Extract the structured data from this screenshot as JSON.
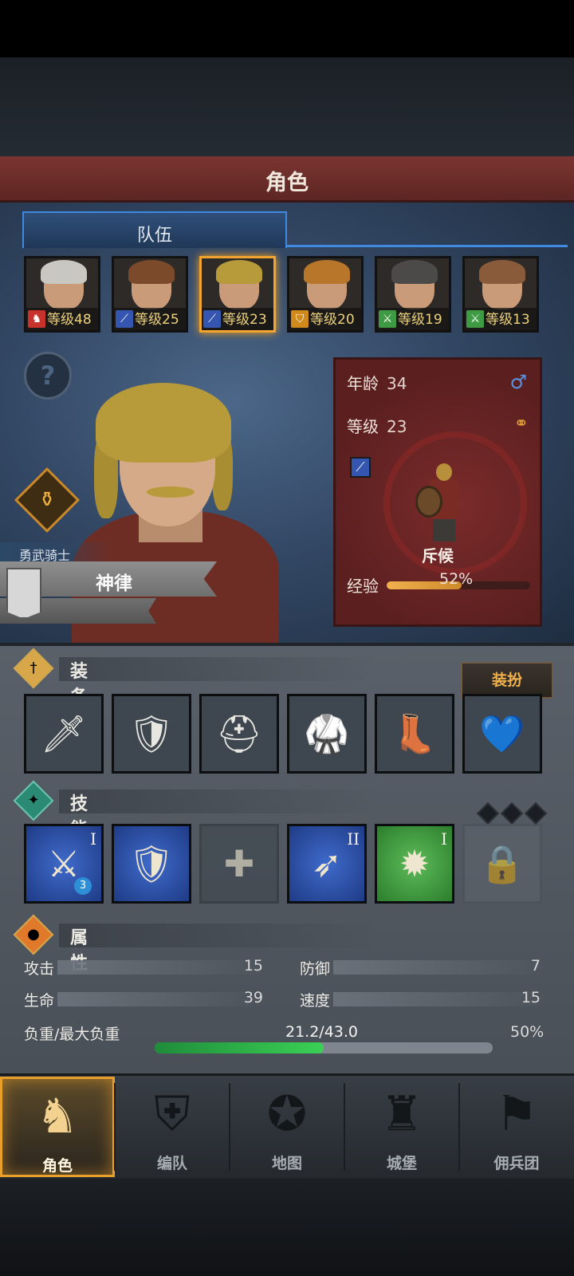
{
  "header": {
    "title": "角色"
  },
  "tabs": {
    "team_label": "队伍"
  },
  "party": [
    {
      "level_text": "等级48",
      "class_icon": "horse-icon",
      "class_color": "#c8322d",
      "hair": "#c9c7c2",
      "selected": false
    },
    {
      "level_text": "等级25",
      "class_icon": "sword-icon",
      "class_color": "#3556b0",
      "hair": "#7a4a2a",
      "selected": false
    },
    {
      "level_text": "等级23",
      "class_icon": "sword-icon",
      "class_color": "#3556b0",
      "hair": "#b79a3a",
      "selected": true
    },
    {
      "level_text": "等级20",
      "class_icon": "shield-icon",
      "class_color": "#d08a1c",
      "hair": "#b7762a",
      "selected": false
    },
    {
      "level_text": "等级19",
      "class_icon": "crossed-swords-icon",
      "class_color": "#3f9b43",
      "hair": "#4b4a48",
      "selected": false
    },
    {
      "level_text": "等级13",
      "class_icon": "crossed-swords-icon",
      "class_color": "#3f9b43",
      "hair": "#8a5b3a",
      "selected": false
    }
  ],
  "character": {
    "rank": "勇武骑士",
    "name": "神律",
    "age_label": "年龄",
    "age_value": "34",
    "level_label": "等级",
    "level_value": "23",
    "class_name": "斥候",
    "xp_label": "经验",
    "xp_value": "52%",
    "xp_fraction": 0.52
  },
  "equipment": {
    "title": "装备",
    "dress_label": "装扮",
    "slots": [
      {
        "name": "dagger",
        "icon": "🗡"
      },
      {
        "name": "round-shield",
        "icon": "🛡"
      },
      {
        "name": "leather-helmet",
        "icon": "⛑"
      },
      {
        "name": "leather-armor",
        "icon": "🥋"
      },
      {
        "name": "leather-boots",
        "icon": "👢"
      },
      {
        "name": "heart-amulet",
        "icon": "💙"
      }
    ]
  },
  "skills": {
    "title": "技能",
    "slots": [
      {
        "name": "blood-strike",
        "roman": "I",
        "badge": "3",
        "style": "blue",
        "icon": "⚔"
      },
      {
        "name": "shield-rush",
        "roman": "",
        "badge": "",
        "style": "blue",
        "icon": "🛡"
      },
      {
        "name": "empty",
        "roman": "",
        "badge": "",
        "style": "empty",
        "icon": "✚"
      },
      {
        "name": "swift-claw",
        "roman": "II",
        "badge": "",
        "style": "blue",
        "icon": "➶"
      },
      {
        "name": "burst",
        "roman": "I",
        "badge": "",
        "style": "green",
        "icon": "✹"
      },
      {
        "name": "locked",
        "roman": "",
        "badge": "",
        "style": "locked",
        "icon": "🔒"
      }
    ]
  },
  "attributes": {
    "title": "属性",
    "attack_label": "攻击",
    "attack_value": "15",
    "defense_label": "防御",
    "defense_value": "7",
    "hp_label": "生命",
    "hp_value": "39",
    "speed_label": "速度",
    "speed_value": "15",
    "load_label": "负重/最大负重",
    "load_value": "21.2/43.0",
    "load_pct": "50%",
    "load_fraction": 0.5
  },
  "nav": [
    {
      "label": "角色",
      "icon": "knight-icon",
      "glyph": "♞",
      "active": true
    },
    {
      "label": "编队",
      "icon": "helmet-icon",
      "glyph": "⛨",
      "active": false
    },
    {
      "label": "地图",
      "icon": "compass-icon",
      "glyph": "✪",
      "active": false
    },
    {
      "label": "城堡",
      "icon": "castle-icon",
      "glyph": "♜",
      "active": false
    },
    {
      "label": "佣兵团",
      "icon": "banner-icon",
      "glyph": "⚑",
      "active": false
    }
  ]
}
